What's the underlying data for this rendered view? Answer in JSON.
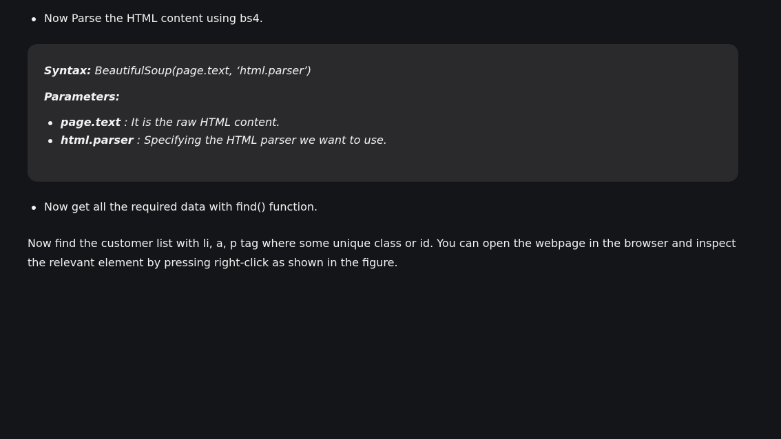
{
  "content": {
    "intro_bullet": "Now Parse the HTML content using bs4.",
    "syntax_box": {
      "syntax_label": "Syntax:",
      "syntax_value": "BeautifulSoup(page.text, ‘html.parser’)",
      "parameters_label": "Parameters:",
      "parameters": [
        {
          "name": "page.text",
          "description": ": It is the raw HTML content."
        },
        {
          "name": "html.parser",
          "description": ": Specifying the HTML parser we want to use."
        }
      ]
    },
    "find_bullet": "Now get all the required data with find() function.",
    "paragraph": "Now find the customer list with li, a, p tag where some unique class or id. You can open the webpage in the browser and inspect the relevant element by pressing right-click as shown in the figure."
  }
}
